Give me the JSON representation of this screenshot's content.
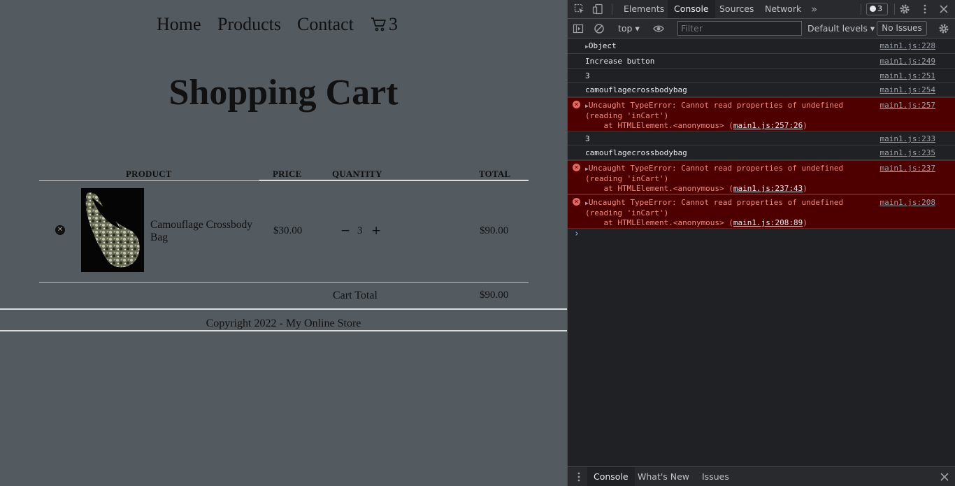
{
  "nav": {
    "home": "Home",
    "products": "Products",
    "contact": "Contact",
    "cart_count": "3"
  },
  "page_title": "Shopping Cart",
  "table": {
    "headers": {
      "product": "PRODUCT",
      "price": "PRICE",
      "quantity": "QUANTITY",
      "total": "TOTAL"
    },
    "items": [
      {
        "name": "Camouflage Crossbody Bag",
        "price": "$30.00",
        "quantity": "3",
        "total": "$90.00"
      }
    ],
    "decrease_symbol": "−",
    "increase_symbol": "+",
    "cart_total_label": "Cart Total",
    "cart_total_value": "$90.00"
  },
  "footer": "Copyright 2022 - My Online Store",
  "devtools": {
    "tabs": [
      "Elements",
      "Console",
      "Sources",
      "Network"
    ],
    "active_tab": "Console",
    "more_tabs": "»",
    "issue_badge": "3",
    "context": "top",
    "filter_placeholder": "Filter",
    "levels": "Default levels",
    "no_issues": "No Issues",
    "console": [
      {
        "type": "object",
        "text": "Object",
        "source": "main1.js:228"
      },
      {
        "type": "log",
        "text": "Increase button",
        "source": "main1.js:249"
      },
      {
        "type": "log",
        "text": "3",
        "source": "main1.js:251"
      },
      {
        "type": "log",
        "text": "camouflagecrossbodybag",
        "source": "main1.js:254"
      },
      {
        "type": "error",
        "line1": "Uncaught TypeError: Cannot read properties of undefined",
        "line2": "(reading 'inCart')",
        "at": "    at HTMLElement.<anonymous> (",
        "link": "main1.js:257:26",
        "close": ")",
        "source": "main1.js:257"
      },
      {
        "type": "log",
        "text": "3",
        "source": "main1.js:233"
      },
      {
        "type": "log",
        "text": "camouflagecrossbodybag",
        "source": "main1.js:235"
      },
      {
        "type": "error",
        "line1": "Uncaught TypeError: Cannot read properties of undefined",
        "line2": "(reading 'inCart')",
        "at": "    at HTMLElement.<anonymous> (",
        "link": "main1.js:237:43",
        "close": ")",
        "source": "main1.js:237"
      },
      {
        "type": "error",
        "line1": "Uncaught TypeError: Cannot read properties of undefined",
        "line2": "(reading 'inCart')",
        "at": "    at HTMLElement.<anonymous> (",
        "link": "main1.js:208:89",
        "close": ")",
        "source": "main1.js:208"
      }
    ],
    "drawer_tabs": [
      "Console",
      "What's New",
      "Issues"
    ]
  }
}
